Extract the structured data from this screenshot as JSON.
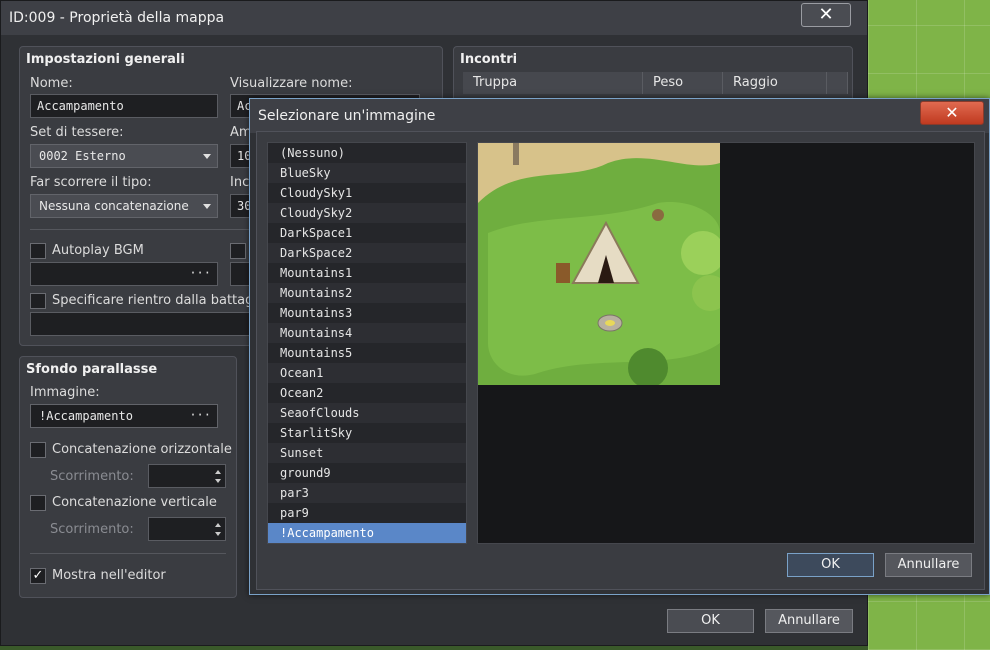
{
  "main": {
    "title": "ID:009 - Proprietà della mappa",
    "close_label": "✕",
    "general": {
      "title": "Impostazioni generali",
      "name_label": "Nome:",
      "name_value": "Accampamento",
      "display_label": "Visualizzare nome:",
      "display_value": "Ac",
      "tileset_label": "Set di tessere:",
      "tileset_value": "0002 Esterno",
      "width_label": "Am",
      "width_value": "10",
      "scroll_label": "Far scorrere il tipo:",
      "scroll_value": "Nessuna concatenazione",
      "height_label": "Inc",
      "height_value": "30",
      "autoplay_bgm": "Autoplay BGM",
      "battle_label": "Specificare rientro dalla battag",
      "browse": "···"
    },
    "encounters": {
      "title": "Incontri",
      "columns": [
        "Truppa",
        "Peso",
        "Raggio"
      ]
    },
    "parallax": {
      "title": "Sfondo parallasse",
      "image_label": "Immagine:",
      "image_value": "!Accampamento",
      "loop_h": "Concatenazione orizzontale",
      "loop_v": "Concatenazione verticale",
      "scroll_label": "Scorrimento:",
      "show_editor": "Mostra nell'editor",
      "check_mark": "✓",
      "browse": "···"
    },
    "ok": "OK",
    "cancel": "Annullare"
  },
  "picker": {
    "title": "Selezionare un'immagine",
    "close_label": "✕",
    "items": [
      "(Nessuno)",
      "BlueSky",
      "CloudySky1",
      "CloudySky2",
      "DarkSpace1",
      "DarkSpace2",
      "Mountains1",
      "Mountains2",
      "Mountains3",
      "Mountains4",
      "Mountains5",
      "Ocean1",
      "Ocean2",
      "SeaofClouds",
      "StarlitSky",
      "Sunset",
      "ground9",
      "par3",
      "par9",
      "!Accampamento"
    ],
    "selected_index": 19,
    "ok": "OK",
    "cancel": "Annullare"
  },
  "colors": {
    "selection": "#5a87c8",
    "accent_close": "#c03a20"
  }
}
